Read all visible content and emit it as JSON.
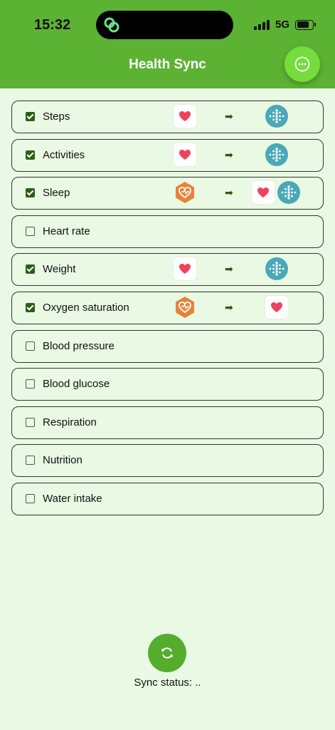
{
  "status_bar": {
    "time": "15:32",
    "network": "5G",
    "battery_level": 0.8
  },
  "header": {
    "title": "Health Sync",
    "accent_color": "#5cb233"
  },
  "rows": [
    {
      "label": "Steps",
      "checked": true,
      "source": "apple-health-icon",
      "targets": [
        "fitbit-icon"
      ]
    },
    {
      "label": "Activities",
      "checked": true,
      "source": "apple-health-icon",
      "targets": [
        "fitbit-icon"
      ]
    },
    {
      "label": "Sleep",
      "checked": true,
      "source": "huawei-health-icon",
      "targets": [
        "apple-health-icon",
        "fitbit-icon"
      ]
    },
    {
      "label": "Heart rate",
      "checked": false,
      "source": null,
      "targets": []
    },
    {
      "label": "Weight",
      "checked": true,
      "source": "apple-health-icon",
      "targets": [
        "fitbit-icon"
      ]
    },
    {
      "label": "Oxygen saturation",
      "checked": true,
      "source": "huawei-health-icon",
      "targets": [
        "apple-health-icon"
      ]
    },
    {
      "label": "Blood pressure",
      "checked": false,
      "source": null,
      "targets": []
    },
    {
      "label": "Blood glucose",
      "checked": false,
      "source": null,
      "targets": []
    },
    {
      "label": "Respiration",
      "checked": false,
      "source": null,
      "targets": []
    },
    {
      "label": "Nutrition",
      "checked": false,
      "source": null,
      "targets": []
    },
    {
      "label": "Water intake",
      "checked": false,
      "source": null,
      "targets": []
    }
  ],
  "arrow_glyph": "➡",
  "sync": {
    "status_text": "Sync status: .."
  },
  "colors": {
    "background": "#e9f9e3",
    "checkbox_checked": "#2d5e17",
    "fitbit": "#4aa8b8",
    "huawei": "#e8823a",
    "heart": "#f0425d"
  }
}
